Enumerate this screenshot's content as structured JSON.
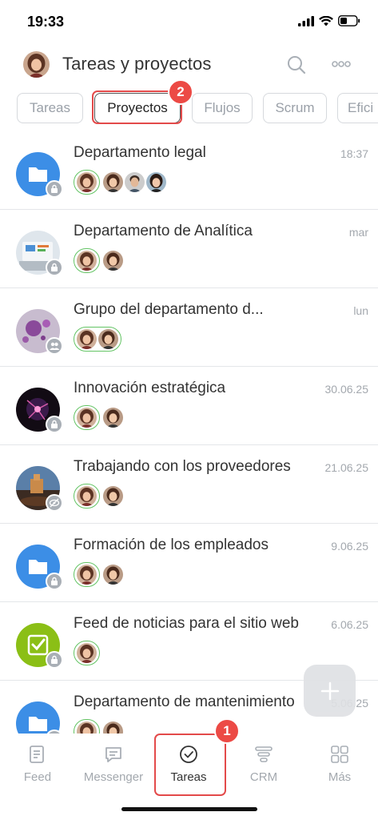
{
  "status_bar": {
    "time": "19:33"
  },
  "header": {
    "title": "Tareas y proyectos",
    "search_icon": "search-icon",
    "more_icon": "more-icon"
  },
  "tabs": [
    {
      "label": "Tareas",
      "active": false
    },
    {
      "label": "Proyectos",
      "active": true
    },
    {
      "label": "Flujos",
      "active": false
    },
    {
      "label": "Scrum",
      "active": false
    },
    {
      "label": "Efici",
      "active": false
    }
  ],
  "annotations": {
    "tabs_badge": "2",
    "nav_badge": "1"
  },
  "projects": [
    {
      "title": "Departamento legal",
      "date": "18:37",
      "avatar": "folder",
      "status_icon": "lock-icon"
    },
    {
      "title": "Departamento de Analítica",
      "date": "mar",
      "avatar": "laptop-photo",
      "status_icon": "lock-icon"
    },
    {
      "title": "Grupo del departamento d...",
      "date": "lun",
      "avatar": "spheres-photo",
      "status_icon": "group-icon"
    },
    {
      "title": "Innovación estratégica",
      "date": "30.06.25",
      "avatar": "plasma-photo",
      "status_icon": "lock-icon"
    },
    {
      "title": "Trabajando con los proveedores",
      "date": "21.06.25",
      "avatar": "castle-photo",
      "status_icon": "eye-off-icon"
    },
    {
      "title": "Formación de los empleados",
      "date": "9.06.25",
      "avatar": "folder",
      "status_icon": "lock-icon"
    },
    {
      "title": "Feed de noticias para el sitio web",
      "date": "6.06.25",
      "avatar": "green-check",
      "status_icon": "lock-icon"
    },
    {
      "title": "Departamento de mantenimiento",
      "date": "5.06.25",
      "avatar": "folder",
      "status_icon": "lock-icon"
    }
  ],
  "bottom_nav": [
    {
      "label": "Feed",
      "icon": "feed-icon",
      "active": false
    },
    {
      "label": "Messenger",
      "icon": "messenger-icon",
      "active": false
    },
    {
      "label": "Tareas",
      "icon": "tasks-icon",
      "active": true
    },
    {
      "label": "CRM",
      "icon": "crm-icon",
      "active": false
    },
    {
      "label": "Más",
      "icon": "more-apps-icon",
      "active": false
    }
  ],
  "colors": {
    "accent_highlight": "#e34a4a",
    "folder_blue": "#3c8ee6",
    "member_green": "#63c464",
    "lime": "#8bbf16"
  }
}
